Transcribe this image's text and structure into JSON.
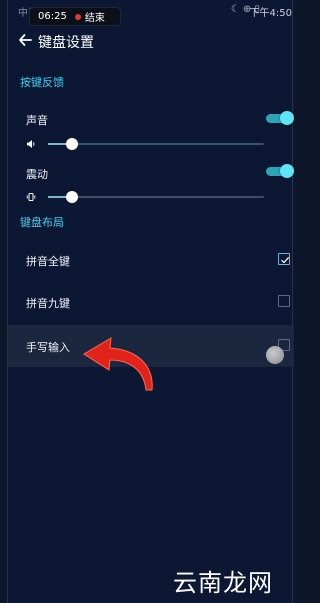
{
  "status": {
    "carrier": "中国移动/小米移动",
    "recording_time": "06:25",
    "recording_stop": "结束",
    "signal_icons": "☾ ⊕ ▯",
    "clock": "下午4:50"
  },
  "header": {
    "title": "键盘设置"
  },
  "sections": {
    "feedback": "按键反馈",
    "layout": "键盘布局"
  },
  "feedback": {
    "sound": {
      "label": "声音",
      "enabled": true,
      "level": 0.11
    },
    "vibration": {
      "label": "震动",
      "enabled": true,
      "level": 0.11
    }
  },
  "layout_options": [
    {
      "label": "拼音全键",
      "checked": true
    },
    {
      "label": "拼音九键",
      "checked": false
    },
    {
      "label": "手写输入",
      "checked": false
    }
  ],
  "watermark": "云南龙网",
  "colors": {
    "accent": "#40d0f0",
    "toggle": "#2aa6b6",
    "arrow": "#e2231a"
  }
}
